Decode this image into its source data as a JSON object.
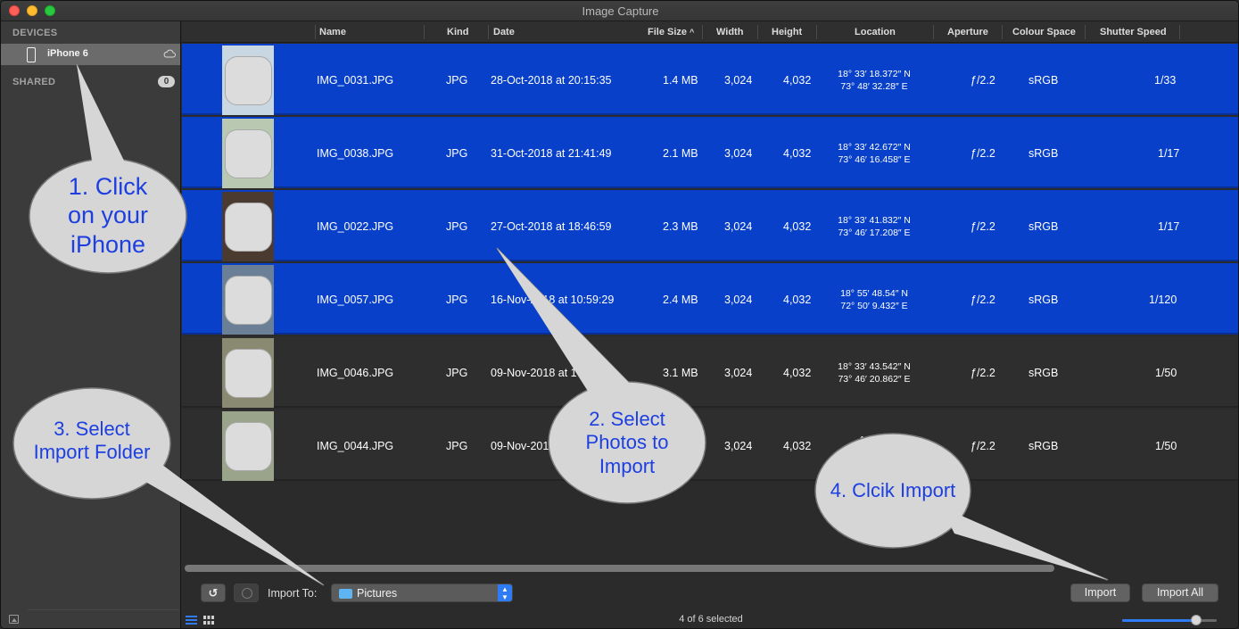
{
  "window": {
    "title": "Image Capture"
  },
  "sidebar": {
    "devices_header": "DEVICES",
    "device": {
      "label": "iPhone 6",
      "icon": "iphone-icon",
      "status_icon": "cloud-icon"
    },
    "shared_header": "SHARED",
    "shared_count": "0"
  },
  "columns": {
    "name": "Name",
    "kind": "Kind",
    "date": "Date",
    "file_size": "File Size",
    "width": "Width",
    "height": "Height",
    "location": "Location",
    "aperture": "Aperture",
    "colour_space": "Colour Space",
    "shutter_speed": "Shutter Speed",
    "sort_indicator": "^"
  },
  "rows": [
    {
      "selected": true,
      "name": "IMG_0031.JPG",
      "kind": "JPG",
      "date": "28-Oct-2018 at 20:15:35",
      "size": "1.4 MB",
      "width": "3,024",
      "height": "4,032",
      "loc1": "18° 33′ 18.372″ N",
      "loc2": "73° 48′ 32.28″ E",
      "aperture": "ƒ/2.2",
      "colour": "sRGB",
      "shutter": "1/33"
    },
    {
      "selected": true,
      "name": "IMG_0038.JPG",
      "kind": "JPG",
      "date": "31-Oct-2018 at 21:41:49",
      "size": "2.1 MB",
      "width": "3,024",
      "height": "4,032",
      "loc1": "18° 33′ 42.672″ N",
      "loc2": "73° 46′ 16.458″ E",
      "aperture": "ƒ/2.2",
      "colour": "sRGB",
      "shutter": "1/17"
    },
    {
      "selected": true,
      "name": "IMG_0022.JPG",
      "kind": "JPG",
      "date": "27-Oct-2018 at 18:46:59",
      "size": "2.3 MB",
      "width": "3,024",
      "height": "4,032",
      "loc1": "18° 33′ 41.832″ N",
      "loc2": "73° 46′ 17.208″ E",
      "aperture": "ƒ/2.2",
      "colour": "sRGB",
      "shutter": "1/17"
    },
    {
      "selected": true,
      "name": "IMG_0057.JPG",
      "kind": "JPG",
      "date": "16-Nov-2018 at 10:59:29",
      "size": "2.4 MB",
      "width": "3,024",
      "height": "4,032",
      "loc1": "18° 55′ 48.54″ N",
      "loc2": "72° 50′ 9.432″ E",
      "aperture": "ƒ/2.2",
      "colour": "sRGB",
      "shutter": "1/120"
    },
    {
      "selected": false,
      "name": "IMG_0046.JPG",
      "kind": "JPG",
      "date": "09-Nov-2018 at 17:25:29",
      "size": "3.1 MB",
      "width": "3,024",
      "height": "4,032",
      "loc1": "18° 33′ 43.542″ N",
      "loc2": "73° 46′ 20.862″ E",
      "aperture": "ƒ/2.2",
      "colour": "sRGB",
      "shutter": "1/50"
    },
    {
      "selected": false,
      "name": "IMG_0044.JPG",
      "kind": "JPG",
      "date": "09-Nov-2018",
      "size": "",
      "width": "3,024",
      "height": "4,032",
      "loc1": "18° 33′",
      "loc2": "",
      "aperture": "ƒ/2.2",
      "colour": "sRGB",
      "shutter": "1/50"
    }
  ],
  "bottom": {
    "rotate_icon": "rotate-left-icon",
    "delete_icon": "delete-icon",
    "import_to_label": "Import To:",
    "folder": "Pictures",
    "folder_icon": "folder-icon",
    "import_label": "Import",
    "import_all_label": "Import All",
    "status": "4 of 6 selected",
    "thumbnail_size": 0.78
  },
  "callouts": {
    "c1": {
      "line1": "1. Click",
      "line2": "on your",
      "line3": "iPhone"
    },
    "c2": {
      "line1": "2. Select",
      "line2": "Photos to",
      "line3": "Import"
    },
    "c3": {
      "line1": "3. Select",
      "line2": "Import Folder"
    },
    "c4": {
      "line1": "4. Clcik Import"
    }
  },
  "colors": {
    "selection": "#0840c9",
    "callout_text": "#1d3fe0",
    "accent": "#2f7cf6"
  }
}
